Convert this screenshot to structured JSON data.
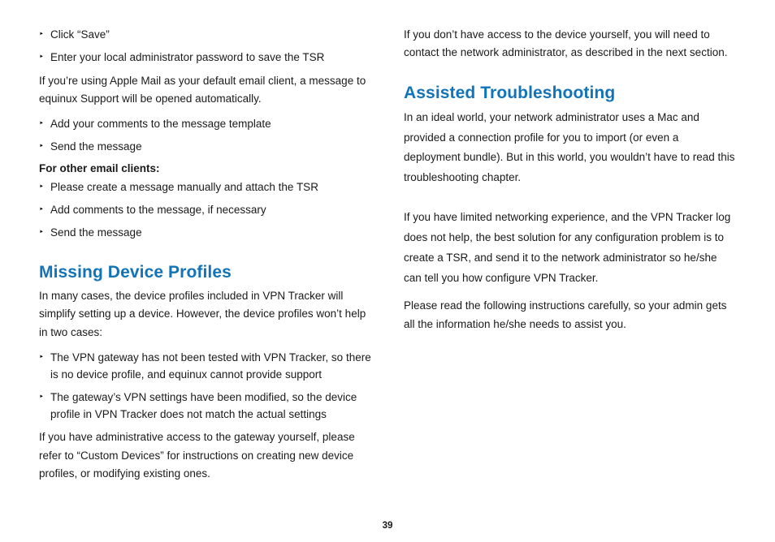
{
  "page_number": "39",
  "left": {
    "bullets_a": [
      "Click “Save”",
      "Enter your local administrator password to save the TSR"
    ],
    "para_a": "If you’re using Apple Mail as your default email client, a message to equinux Support will be opened automatically.",
    "bullets_b": [
      "Add your comments to the message template",
      "Send the message"
    ],
    "bold_b": "For other email clients:",
    "bullets_c": [
      "Please create a message manually and attach the TSR",
      "Add comments to the message, if necessary",
      "Send the message"
    ],
    "heading1": "Missing Device Profiles",
    "para_c": "In many cases, the device profiles included in VPN Tracker will simplify setting up a device. However, the device profiles won’t help in two cases:",
    "bullets_d": [
      "The VPN gateway has not been tested with VPN Tracker, so there is no device profile, and equinux cannot provide support",
      "The gateway’s VPN settings have been modified, so the device profile in VPN Tracker does not match the actual settings"
    ],
    "para_d": "If you have administrative access to the gateway yourself, please refer to “Custom Devices” for instructions on creating new device profiles, or modifying existing ones."
  },
  "right": {
    "para_a": "If you don’t have access to the device yourself, you will need to contact the network administrator, as described in the next section.",
    "heading1": "Assisted Troubleshooting",
    "para_b": "In an ideal world, your network administrator uses a Mac and provided a connection profile for you to import (or even a deployment bundle). But in this world, you wouldn’t have to read this troubleshooting chapter.",
    "para_c": "If you have limited networking experience, and the VPN Tracker log does not help, the best solution for any configuration problem is to create a TSR, and send it to the network administrator so he/she can tell you how configure VPN Tracker.",
    "para_d": "Please read the following instructions carefully, so your admin gets all the information he/she needs to assist you."
  }
}
